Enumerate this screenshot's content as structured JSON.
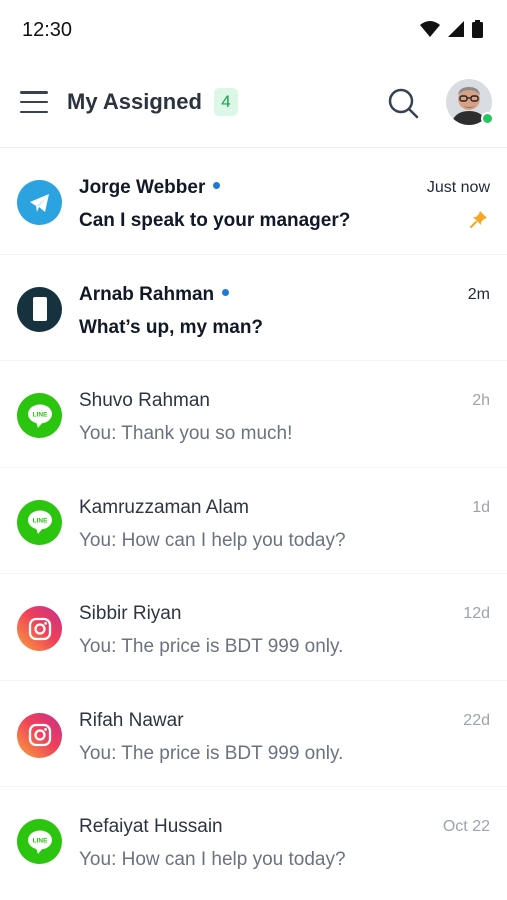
{
  "status_bar": {
    "time": "12:30",
    "icons": [
      "wifi-icon",
      "signal-icon",
      "battery-icon"
    ]
  },
  "header": {
    "title": "My Assigned",
    "count": "4",
    "menu_icon": "hamburger-menu-icon",
    "search_icon": "search-icon",
    "avatar_status": "online"
  },
  "colors": {
    "accent_green": "#16a34a",
    "badge_bg": "#dcf7e8",
    "unread_dot": "#1d7bd8",
    "pin": "#f5a623",
    "telegram": "#2aa3e0",
    "line": "#2bc40e",
    "phone": "#17323f"
  },
  "conversations": [
    {
      "name": "Jorge Webber",
      "message": "Can I speak to your manager?",
      "time": "Just now",
      "channel": "telegram",
      "unread": true,
      "pinned": true
    },
    {
      "name": "Arnab Rahman",
      "message": "What’s up, my man?",
      "time": "2m",
      "channel": "phone",
      "unread": true,
      "pinned": false
    },
    {
      "name": "Shuvo Rahman",
      "message": "You: Thank you so much!",
      "time": "2h",
      "channel": "line",
      "unread": false,
      "pinned": false
    },
    {
      "name": "Kamruzzaman Alam",
      "message": "You: How can I help you today?",
      "time": "1d",
      "channel": "line",
      "unread": false,
      "pinned": false
    },
    {
      "name": "Sibbir Riyan",
      "message": "You: The price is BDT 999 only.",
      "time": "12d",
      "channel": "instagram",
      "unread": false,
      "pinned": false
    },
    {
      "name": "Rifah Nawar",
      "message": "You: The price is BDT 999 only.",
      "time": "22d",
      "channel": "instagram",
      "unread": false,
      "pinned": false
    },
    {
      "name": "Refaiyat Hussain",
      "message": "You: How can I help you today?",
      "time": "Oct 22",
      "channel": "line",
      "unread": false,
      "pinned": false
    }
  ]
}
